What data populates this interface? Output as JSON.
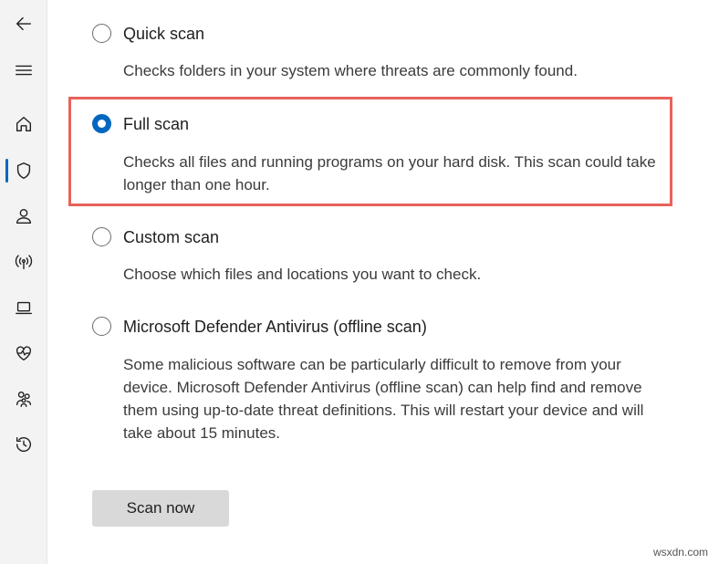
{
  "sidebar": {
    "items": [
      {
        "name": "back-arrow-icon"
      },
      {
        "name": "hamburger-menu-icon"
      },
      {
        "name": "home-icon"
      },
      {
        "name": "shield-icon"
      },
      {
        "name": "person-icon"
      },
      {
        "name": "wireless-antenna-icon"
      },
      {
        "name": "laptop-icon"
      },
      {
        "name": "heart-pulse-icon"
      },
      {
        "name": "family-icon"
      },
      {
        "name": "history-icon"
      }
    ],
    "active_item": "shield-icon"
  },
  "scan_options": [
    {
      "title": "Quick scan",
      "description": "Checks folders in your system where threats are commonly found.",
      "selected": false
    },
    {
      "title": "Full scan",
      "description": "Checks all files and running programs on your hard disk. This scan could take longer than one hour.",
      "selected": true
    },
    {
      "title": "Custom scan",
      "description": "Choose which files and locations you want to check.",
      "selected": false
    },
    {
      "title": "Microsoft Defender Antivirus (offline scan)",
      "description": "Some malicious software can be particularly difficult to remove from your device. Microsoft Defender Antivirus (offline scan) can help find and remove them using up-to-date threat definitions. This will restart your device and will take about 15 minutes.",
      "selected": false
    }
  ],
  "scan_now_label": "Scan now",
  "highlight_color": "#e8625a",
  "accent_color": "#0067c0",
  "watermark": "wsxdn.com"
}
